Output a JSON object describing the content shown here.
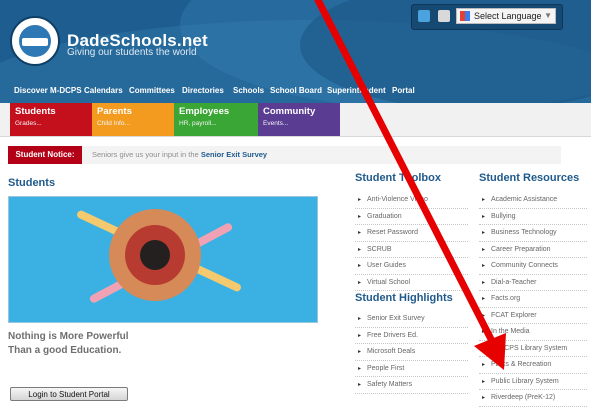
{
  "header": {
    "site_name": "DadeSchools.net",
    "tagline": "Giving our students the world",
    "language_label": "Select Language",
    "language_arrow": "▼"
  },
  "topnav": [
    "Discover M-DCPS",
    "Calendars",
    "Committees",
    "Directories",
    "Schools",
    "School Board",
    "Superintendent",
    "Portal"
  ],
  "tiles": [
    {
      "title": "Students",
      "sub": "Grades...",
      "color": "#c40f1d"
    },
    {
      "title": "Parents",
      "sub": "Child Info...",
      "color": "#f39b1e"
    },
    {
      "title": "Employees",
      "sub": "HR, payroll...",
      "color": "#3aa635"
    },
    {
      "title": "Community",
      "sub": "Events...",
      "color": "#5a3c93"
    }
  ],
  "notice": {
    "label": "Student Notice:",
    "text": "Seniors give us your input in the ",
    "link": "Senior Exit Survey"
  },
  "students": {
    "heading": "Students",
    "tagline_line1": "Nothing is More Powerful",
    "tagline_line2": "Than a good Education.",
    "login_button": "Login to Student Portal"
  },
  "toolbox": {
    "heading": "Student Toolbox",
    "items": [
      "Anti-Violence Video",
      "Graduation",
      "Reset Password",
      "SCRUB",
      "User Guides",
      "Virtual School"
    ]
  },
  "highlights": {
    "heading": "Student Highlights",
    "items": [
      "Senior Exit Survey",
      "Free Drivers Ed.",
      "Microsoft Deals",
      "People First",
      "Safety Matters"
    ]
  },
  "resources": {
    "heading": "Student Resources",
    "items": [
      "Academic Assistance",
      "Bullying",
      "Business Technology",
      "Career Preparation",
      "Community Connects",
      "Dial-a-Teacher",
      "Facts.org",
      "FCAT Explorer",
      "In the Media",
      "M-DCPS Library System",
      "Parks & Recreation",
      "Public Library System",
      "Riverdeep (PreK-12)"
    ]
  },
  "colors": {
    "header_blue": "#1e5d8f",
    "heading_blue": "#1f5a8c",
    "notice_red": "#b40016",
    "arrow_red": "#e60000"
  },
  "icons": [
    "facebook-icon",
    "email-icon",
    "google-translate-icon",
    "dropdown-arrow-icon",
    "bullet-icon"
  ]
}
